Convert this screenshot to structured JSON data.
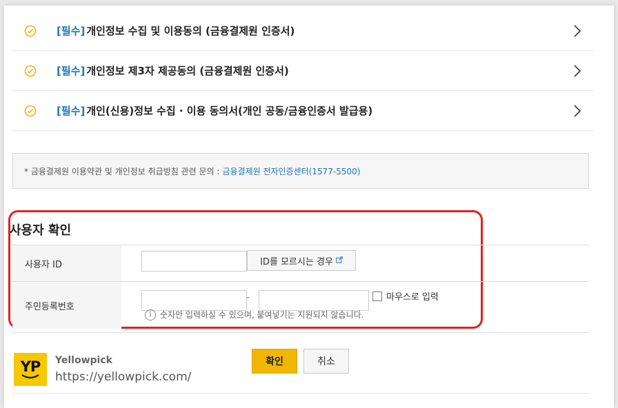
{
  "agreements": [
    {
      "req": "[필수]",
      "title": "개인정보 수집 및 이용동의 (금융결제원 인증서)"
    },
    {
      "req": "[필수]",
      "title": "개인정보 제3자 제공동의 (금융결제원 인증서)"
    },
    {
      "req": "[필수]",
      "title": "개인(신용)정보 수집 · 이용 동의서(개인 공동/금융인증서 발급용)"
    }
  ],
  "notice": {
    "text": "* 금융결제원 이용약관 및 개인정보 취급방침 관련 문의 :",
    "link": "금융결제원 전자인증센터(1577-5500)"
  },
  "verify": {
    "title": "사용자 확인",
    "user_id_label": "사용자 ID",
    "user_id_value": "",
    "id_help_label": "ID를 모르시는 경우",
    "rrn_label": "주민등록번호",
    "rrn_front_value": "",
    "rrn_dash": "-",
    "rrn_back_value": "",
    "mouse_input_label": "마우스로 입력",
    "hint": "숫자만 입력하실 수 있으며, 붙여넣기는 지원되지 않습니다."
  },
  "buttons": {
    "ok": "확인",
    "cancel": "취소"
  },
  "watermark": {
    "logo": "YP",
    "name": "Yellowpick",
    "url": "https://yellowpick.com/"
  },
  "colors": {
    "required": "#1d76b7",
    "check_icon": "#f0b400",
    "highlight_border": "#e0221f",
    "ok_button": "#f2b705"
  },
  "icons": {
    "check": "circle-check-icon",
    "chevron": "chevron-right-icon",
    "external": "external-link-icon",
    "info": "info-icon"
  }
}
